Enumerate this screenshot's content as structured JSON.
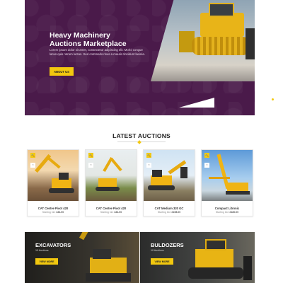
{
  "hero": {
    "title_line1": "Heavy Machinery",
    "title_line2": "Auctions Marketplace",
    "text": "Lorem ipsum dolor sit amet, consectetur adipiscing elit. Morbi congue lacus quis rutrum luctus. Sed commodo risus a mauris tincidunt lacinia.",
    "button_label": "ABOUT US"
  },
  "auctions": {
    "section_title": "LATEST AUCTIONS",
    "items": [
      {
        "name": "CAT Center-Pivot 420",
        "price_label": "Starting bid:",
        "price": "£34.00"
      },
      {
        "name": "CAT Center-Pivot 420",
        "price_label": "Starting bid:",
        "price": "£34.00"
      },
      {
        "name": "CAT Medium 320 GC",
        "price_label": "Starting bid:",
        "price": "£198.00"
      },
      {
        "name": "Compact Litronic",
        "price_label": "Starting bid:",
        "price": "£180.00"
      }
    ]
  },
  "categories": [
    {
      "title": "EXCAVATORS",
      "count": "10 Auctions",
      "button_label": "VIEW MORE"
    },
    {
      "title": "BULDOZERS",
      "count": "10 Auctions",
      "button_label": "VIEW MORE"
    }
  ],
  "colors": {
    "hero_bg": "#4a1a4a",
    "accent": "#f2c80f",
    "machinery_yellow": "#f0b414"
  },
  "icons": {
    "card_badge": "hammer-icon",
    "card_secondary": "heart-icon"
  }
}
